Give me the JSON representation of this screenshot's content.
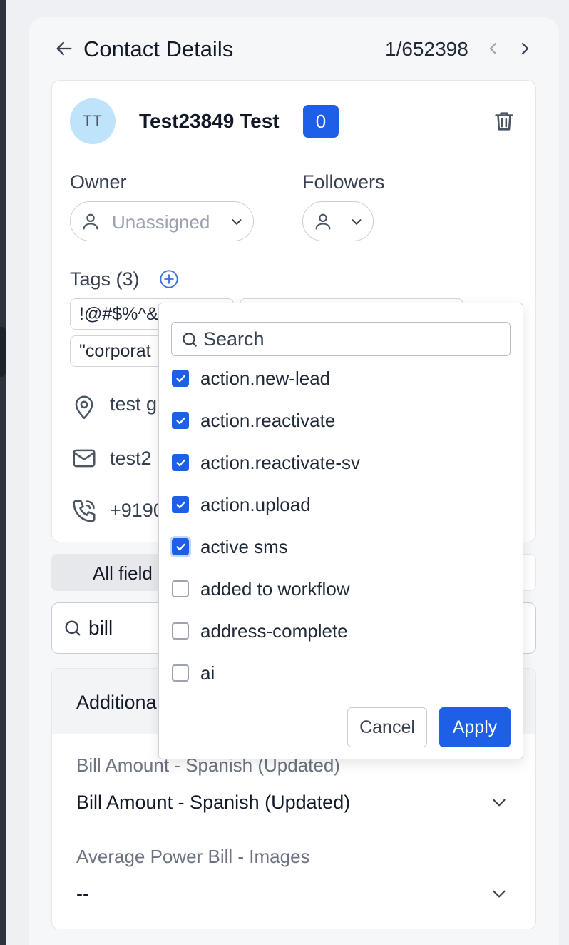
{
  "header": {
    "title": "Contact Details",
    "counter": "1/652398"
  },
  "contact": {
    "initials": "TT",
    "name": "Test23849 Test",
    "badge_count": "0"
  },
  "owner": {
    "label": "Owner",
    "value": "Unassigned"
  },
  "followers": {
    "label": "Followers"
  },
  "tags": {
    "label": "Tags (3)",
    "chips": [
      "!@#$%^&",
      "",
      "\"corporat"
    ]
  },
  "info": {
    "address": "test g",
    "email": "test2",
    "phone": "+9190"
  },
  "tabs": {
    "active_label": "All field"
  },
  "field_search": {
    "value": "bill"
  },
  "section": {
    "title": "Additional",
    "fields": [
      {
        "label": "Bill Amount - Spanish (Updated)",
        "value": "Bill Amount - Spanish (Updated)"
      },
      {
        "label": "Average Power Bill - Images",
        "value": "--"
      }
    ]
  },
  "dropdown": {
    "search_placeholder": "Search",
    "options": [
      {
        "label": "action.new-lead",
        "checked": true
      },
      {
        "label": "action.reactivate",
        "checked": true
      },
      {
        "label": "action.reactivate-sv",
        "checked": true
      },
      {
        "label": "action.upload",
        "checked": true
      },
      {
        "label": "active sms",
        "checked": true
      },
      {
        "label": "added to workflow",
        "checked": false
      },
      {
        "label": "address-complete",
        "checked": false
      },
      {
        "label": "ai",
        "checked": false
      }
    ],
    "cancel_label": "Cancel",
    "apply_label": "Apply"
  },
  "colors": {
    "accent": "#1d5fe6",
    "avatar_bg": "#bfe3fb"
  },
  "icons": [
    "arrow-left-icon",
    "chevron-left-icon",
    "chevron-right-icon",
    "trash-icon",
    "user-icon",
    "chevron-down-icon",
    "plus-circle-icon",
    "map-pin-icon",
    "mail-icon",
    "phone-icon",
    "search-icon",
    "check-icon"
  ]
}
